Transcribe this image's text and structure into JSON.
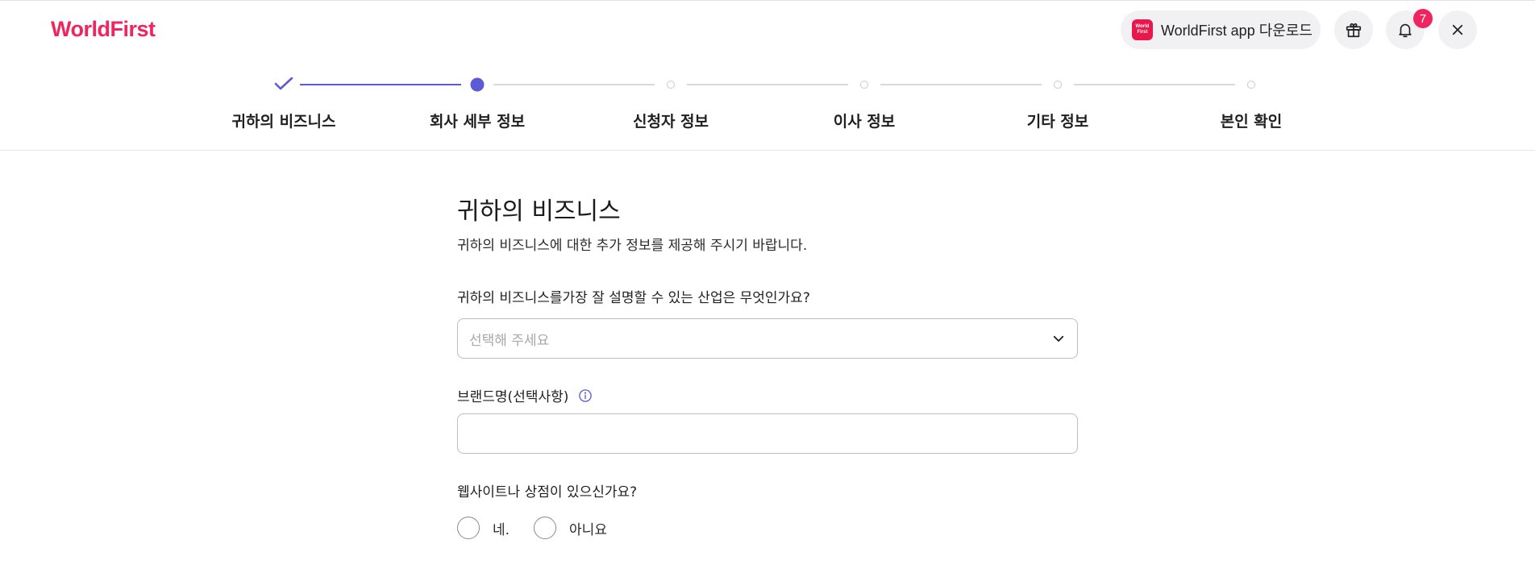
{
  "header": {
    "logo_text": "WorldFirst",
    "brand_color": "#f0245e",
    "app_download": {
      "icon_text_line1": "World",
      "icon_text_line2": "First",
      "label": "WorldFirst app 다운로드"
    },
    "notification_count": "7",
    "icons": [
      "gift-icon",
      "bell-icon",
      "close-icon"
    ]
  },
  "stepper": {
    "accent_color": "#5b5bd6",
    "steps": [
      {
        "label": "귀하의 비즈니스",
        "status": "completed"
      },
      {
        "label": "회사 세부 정보",
        "status": "current"
      },
      {
        "label": "신청자 정보",
        "status": "upcoming"
      },
      {
        "label": "이사 정보",
        "status": "upcoming"
      },
      {
        "label": "기타 정보",
        "status": "upcoming"
      },
      {
        "label": "본인 확인",
        "status": "upcoming"
      }
    ]
  },
  "form": {
    "title": "귀하의 비즈니스",
    "subtitle": "귀하의 비즈니스에 대한 추가 정보를 제공해 주시기 바랍니다.",
    "industry": {
      "label": "귀하의 비즈니스를가장 잘 설명할 수 있는 산업은 무엇인가요?",
      "placeholder": "선택해 주세요"
    },
    "brand_name": {
      "label": "브랜드명(선택사항)",
      "value": ""
    },
    "website_question": {
      "label": "웹사이트나 상점이 있으신가요?",
      "options": [
        "네.",
        "아니요"
      ]
    }
  }
}
